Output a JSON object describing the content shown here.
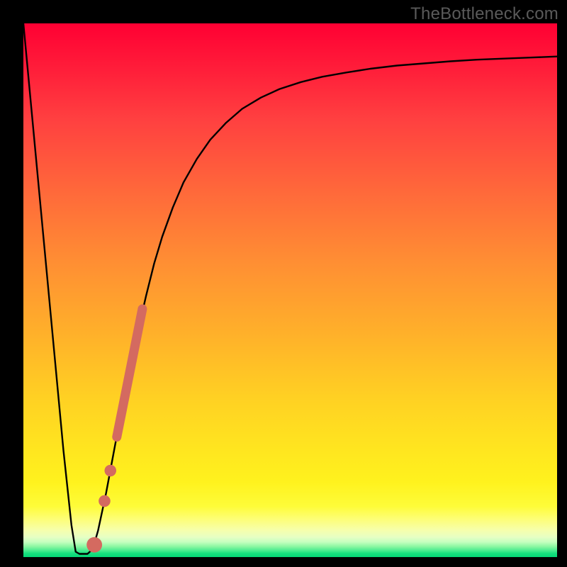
{
  "watermark": "TheBottleneck.com",
  "chart_data": {
    "type": "line",
    "title": "",
    "xlabel": "",
    "ylabel": "",
    "xlim": [
      0,
      100
    ],
    "ylim": [
      0,
      100
    ],
    "series": [
      {
        "name": "bottleneck-curve",
        "x": [
          0.0,
          1.5,
          3.0,
          4.5,
          6.0,
          7.5,
          9.0,
          9.8,
          10.5,
          11.2,
          12.0,
          13.0,
          14.0,
          15.5,
          17.0,
          18.5,
          20.0,
          21.5,
          23.0,
          24.5,
          26.0,
          28.0,
          30.0,
          32.5,
          35.0,
          38.0,
          41.0,
          44.5,
          48.0,
          52.0,
          56.0,
          60.5,
          65.0,
          70.0,
          75.0,
          80.0,
          85.0,
          90.0,
          95.0,
          100.0
        ],
        "y": [
          100.0,
          84.0,
          68.0,
          52.0,
          36.0,
          20.0,
          6.0,
          1.0,
          0.6,
          0.6,
          0.6,
          1.5,
          5.0,
          12.0,
          20.0,
          28.0,
          35.5,
          42.5,
          49.0,
          55.0,
          60.0,
          65.5,
          70.2,
          74.6,
          78.2,
          81.4,
          84.0,
          86.1,
          87.7,
          89.0,
          90.0,
          90.8,
          91.5,
          92.1,
          92.5,
          92.9,
          93.2,
          93.4,
          93.6,
          93.8
        ]
      }
    ],
    "markers": [
      {
        "name": "highlight-segment",
        "shape": "thick-line",
        "x0": 17.5,
        "y0": 22.5,
        "x1": 22.3,
        "y1": 46.5
      },
      {
        "name": "dot-1",
        "shape": "circle",
        "x": 16.3,
        "y": 16.2,
        "r": 1.1
      },
      {
        "name": "dot-2",
        "shape": "circle",
        "x": 15.2,
        "y": 10.5,
        "r": 1.1
      },
      {
        "name": "dot-3",
        "shape": "circle",
        "x": 13.3,
        "y": 2.3,
        "r": 1.45
      }
    ],
    "colors": {
      "curve": "#000000",
      "marker": "#d46a60"
    }
  }
}
